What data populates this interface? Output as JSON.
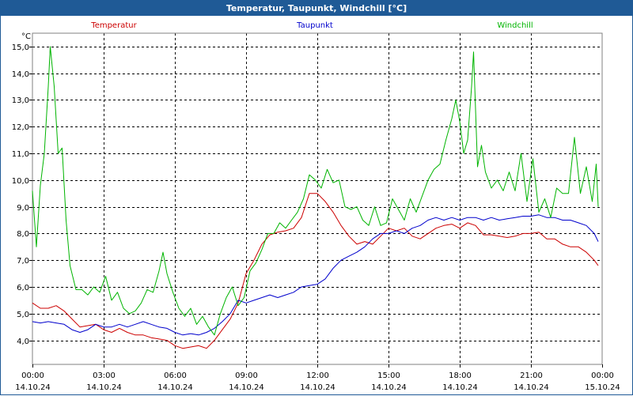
{
  "window": {
    "title": "Temperatur, Taupunkt, Windchill [°C]"
  },
  "colors": {
    "titlebar": "#1f5a96",
    "temperatur": "#cc0000",
    "taupunkt": "#0000cc",
    "windchill": "#00b400",
    "grid": "#000000"
  },
  "chart_data": {
    "type": "line",
    "title": "Temperatur, Taupunkt, Windchill [°C]",
    "ylabel": "°C",
    "xlabel": "",
    "grid": true,
    "legend_position": "top",
    "xlim": [
      "14.10.24 00:00",
      "15.10.24 00:00"
    ],
    "ylim": [
      3.1,
      15.5
    ],
    "y_ticks": [
      "4,0",
      "5,0",
      "6,0",
      "7,0",
      "8,0",
      "9,0",
      "10,0",
      "11,0",
      "12,0",
      "13,0",
      "14,0",
      "15,0"
    ],
    "x_ticks": [
      {
        "time": "00:00",
        "date": "14.10.24"
      },
      {
        "time": "03:00",
        "date": "14.10.24"
      },
      {
        "time": "06:00",
        "date": "14.10.24"
      },
      {
        "time": "09:00",
        "date": "14.10.24"
      },
      {
        "time": "12:00",
        "date": "14.10.24"
      },
      {
        "time": "15:00",
        "date": "14.10.24"
      },
      {
        "time": "18:00",
        "date": "14.10.24"
      },
      {
        "time": "21:00",
        "date": "14.10.24"
      },
      {
        "time": "00:00",
        "date": "15.10.24"
      }
    ],
    "series": [
      {
        "name": "Temperatur",
        "color": "#cc0000",
        "points": [
          [
            "00:00",
            5.4
          ],
          [
            "00:20",
            5.2
          ],
          [
            "00:40",
            5.2
          ],
          [
            "01:00",
            5.3
          ],
          [
            "01:20",
            5.1
          ],
          [
            "01:40",
            4.8
          ],
          [
            "02:00",
            4.5
          ],
          [
            "02:20",
            4.55
          ],
          [
            "02:40",
            4.6
          ],
          [
            "03:00",
            4.4
          ],
          [
            "03:20",
            4.3
          ],
          [
            "03:40",
            4.45
          ],
          [
            "04:00",
            4.3
          ],
          [
            "04:20",
            4.2
          ],
          [
            "04:40",
            4.2
          ],
          [
            "05:00",
            4.1
          ],
          [
            "05:20",
            4.05
          ],
          [
            "05:40",
            4.0
          ],
          [
            "06:00",
            3.8
          ],
          [
            "06:20",
            3.7
          ],
          [
            "06:40",
            3.75
          ],
          [
            "07:00",
            3.8
          ],
          [
            "07:20",
            3.7
          ],
          [
            "07:40",
            4.0
          ],
          [
            "08:00",
            4.4
          ],
          [
            "08:20",
            4.8
          ],
          [
            "08:40",
            5.4
          ],
          [
            "09:00",
            6.5
          ],
          [
            "09:20",
            7.0
          ],
          [
            "09:40",
            7.6
          ],
          [
            "10:00",
            7.95
          ],
          [
            "10:20",
            8.05
          ],
          [
            "10:40",
            8.1
          ],
          [
            "11:00",
            8.2
          ],
          [
            "11:20",
            8.6
          ],
          [
            "11:40",
            9.5
          ],
          [
            "12:00",
            9.5
          ],
          [
            "12:20",
            9.2
          ],
          [
            "12:40",
            8.8
          ],
          [
            "13:00",
            8.3
          ],
          [
            "13:20",
            7.9
          ],
          [
            "13:40",
            7.6
          ],
          [
            "14:00",
            7.7
          ],
          [
            "14:20",
            7.6
          ],
          [
            "14:40",
            7.9
          ],
          [
            "15:00",
            8.2
          ],
          [
            "15:20",
            8.1
          ],
          [
            "15:40",
            8.2
          ],
          [
            "16:00",
            7.9
          ],
          [
            "16:20",
            7.8
          ],
          [
            "16:40",
            8.0
          ],
          [
            "17:00",
            8.2
          ],
          [
            "17:20",
            8.3
          ],
          [
            "17:40",
            8.35
          ],
          [
            "18:00",
            8.2
          ],
          [
            "18:20",
            8.4
          ],
          [
            "18:40",
            8.3
          ],
          [
            "19:00",
            7.95
          ],
          [
            "19:20",
            7.95
          ],
          [
            "19:40",
            7.9
          ],
          [
            "20:00",
            7.85
          ],
          [
            "20:20",
            7.9
          ],
          [
            "20:40",
            8.0
          ],
          [
            "21:00",
            8.0
          ],
          [
            "21:20",
            8.05
          ],
          [
            "21:40",
            7.8
          ],
          [
            "22:00",
            7.8
          ],
          [
            "22:20",
            7.6
          ],
          [
            "22:40",
            7.5
          ],
          [
            "23:00",
            7.5
          ],
          [
            "23:20",
            7.3
          ],
          [
            "23:40",
            7.0
          ],
          [
            "23:50",
            6.8
          ]
        ]
      },
      {
        "name": "Taupunkt",
        "color": "#0000cc",
        "points": [
          [
            "00:00",
            4.7
          ],
          [
            "00:20",
            4.65
          ],
          [
            "00:40",
            4.7
          ],
          [
            "01:00",
            4.65
          ],
          [
            "01:20",
            4.6
          ],
          [
            "01:40",
            4.4
          ],
          [
            "02:00",
            4.3
          ],
          [
            "02:20",
            4.4
          ],
          [
            "02:40",
            4.6
          ],
          [
            "03:00",
            4.5
          ],
          [
            "03:20",
            4.5
          ],
          [
            "03:40",
            4.6
          ],
          [
            "04:00",
            4.5
          ],
          [
            "04:20",
            4.6
          ],
          [
            "04:40",
            4.7
          ],
          [
            "05:00",
            4.6
          ],
          [
            "05:20",
            4.5
          ],
          [
            "05:40",
            4.45
          ],
          [
            "06:00",
            4.3
          ],
          [
            "06:20",
            4.2
          ],
          [
            "06:40",
            4.25
          ],
          [
            "07:00",
            4.2
          ],
          [
            "07:20",
            4.3
          ],
          [
            "07:40",
            4.45
          ],
          [
            "08:00",
            4.7
          ],
          [
            "08:20",
            5.0
          ],
          [
            "08:40",
            5.5
          ],
          [
            "09:00",
            5.4
          ],
          [
            "09:20",
            5.5
          ],
          [
            "09:40",
            5.6
          ],
          [
            "10:00",
            5.7
          ],
          [
            "10:20",
            5.6
          ],
          [
            "10:40",
            5.7
          ],
          [
            "11:00",
            5.8
          ],
          [
            "11:20",
            6.0
          ],
          [
            "11:40",
            6.05
          ],
          [
            "12:00",
            6.1
          ],
          [
            "12:20",
            6.3
          ],
          [
            "12:40",
            6.7
          ],
          [
            "13:00",
            7.0
          ],
          [
            "13:20",
            7.15
          ],
          [
            "13:40",
            7.3
          ],
          [
            "14:00",
            7.5
          ],
          [
            "14:20",
            7.8
          ],
          [
            "14:40",
            8.0
          ],
          [
            "15:00",
            8.0
          ],
          [
            "15:20",
            8.1
          ],
          [
            "15:40",
            8.0
          ],
          [
            "16:00",
            8.2
          ],
          [
            "16:20",
            8.3
          ],
          [
            "16:40",
            8.5
          ],
          [
            "17:00",
            8.6
          ],
          [
            "17:20",
            8.5
          ],
          [
            "17:40",
            8.6
          ],
          [
            "18:00",
            8.5
          ],
          [
            "18:20",
            8.6
          ],
          [
            "18:40",
            8.6
          ],
          [
            "19:00",
            8.5
          ],
          [
            "19:20",
            8.6
          ],
          [
            "19:40",
            8.5
          ],
          [
            "20:00",
            8.55
          ],
          [
            "20:20",
            8.6
          ],
          [
            "20:40",
            8.65
          ],
          [
            "21:00",
            8.65
          ],
          [
            "21:20",
            8.7
          ],
          [
            "21:40",
            8.6
          ],
          [
            "22:00",
            8.6
          ],
          [
            "22:20",
            8.5
          ],
          [
            "22:40",
            8.5
          ],
          [
            "23:00",
            8.4
          ],
          [
            "23:20",
            8.3
          ],
          [
            "23:40",
            8.0
          ],
          [
            "23:50",
            7.7
          ]
        ]
      },
      {
        "name": "Windchill",
        "color": "#00b400",
        "points": [
          [
            "00:00",
            9.6
          ],
          [
            "00:10",
            7.5
          ],
          [
            "00:20",
            9.8
          ],
          [
            "00:30",
            11.0
          ],
          [
            "00:40",
            13.5
          ],
          [
            "00:45",
            15.0
          ],
          [
            "00:55",
            13.5
          ],
          [
            "01:05",
            11.0
          ],
          [
            "01:15",
            11.2
          ],
          [
            "01:25",
            8.5
          ],
          [
            "01:35",
            6.8
          ],
          [
            "01:50",
            5.9
          ],
          [
            "02:05",
            5.9
          ],
          [
            "02:20",
            5.7
          ],
          [
            "02:35",
            6.0
          ],
          [
            "02:50",
            5.8
          ],
          [
            "03:05",
            6.4
          ],
          [
            "03:20",
            5.5
          ],
          [
            "03:35",
            5.8
          ],
          [
            "03:50",
            5.2
          ],
          [
            "04:05",
            5.0
          ],
          [
            "04:20",
            5.1
          ],
          [
            "04:35",
            5.4
          ],
          [
            "04:50",
            5.9
          ],
          [
            "05:05",
            5.8
          ],
          [
            "05:20",
            6.6
          ],
          [
            "05:30",
            7.3
          ],
          [
            "05:40",
            6.5
          ],
          [
            "05:55",
            5.8
          ],
          [
            "06:10",
            5.2
          ],
          [
            "06:25",
            4.9
          ],
          [
            "06:40",
            5.2
          ],
          [
            "06:55",
            4.6
          ],
          [
            "07:10",
            4.9
          ],
          [
            "07:25",
            4.5
          ],
          [
            "07:40",
            4.2
          ],
          [
            "07:55",
            5.0
          ],
          [
            "08:10",
            5.6
          ],
          [
            "08:25",
            6.0
          ],
          [
            "08:40",
            5.3
          ],
          [
            "08:55",
            5.6
          ],
          [
            "09:10",
            6.6
          ],
          [
            "09:25",
            6.9
          ],
          [
            "09:40",
            7.4
          ],
          [
            "09:55",
            8.0
          ],
          [
            "10:10",
            8.0
          ],
          [
            "10:25",
            8.4
          ],
          [
            "10:40",
            8.2
          ],
          [
            "10:55",
            8.5
          ],
          [
            "11:10",
            8.8
          ],
          [
            "11:25",
            9.3
          ],
          [
            "11:40",
            10.2
          ],
          [
            "11:55",
            10.0
          ],
          [
            "12:10",
            9.7
          ],
          [
            "12:25",
            10.4
          ],
          [
            "12:40",
            9.9
          ],
          [
            "12:55",
            10.0
          ],
          [
            "13:10",
            9.0
          ],
          [
            "13:25",
            8.9
          ],
          [
            "13:40",
            9.0
          ],
          [
            "13:55",
            8.5
          ],
          [
            "14:10",
            8.3
          ],
          [
            "14:25",
            9.0
          ],
          [
            "14:40",
            8.3
          ],
          [
            "14:55",
            8.4
          ],
          [
            "15:10",
            9.3
          ],
          [
            "15:25",
            8.9
          ],
          [
            "15:40",
            8.5
          ],
          [
            "15:55",
            9.3
          ],
          [
            "16:10",
            8.8
          ],
          [
            "16:25",
            9.4
          ],
          [
            "16:40",
            10.0
          ],
          [
            "16:55",
            10.4
          ],
          [
            "17:10",
            10.6
          ],
          [
            "17:25",
            11.5
          ],
          [
            "17:40",
            12.3
          ],
          [
            "17:50",
            13.0
          ],
          [
            "18:00",
            12.2
          ],
          [
            "18:10",
            11.0
          ],
          [
            "18:20",
            11.5
          ],
          [
            "18:30",
            13.5
          ],
          [
            "18:35",
            14.8
          ],
          [
            "18:45",
            10.5
          ],
          [
            "18:55",
            11.3
          ],
          [
            "19:05",
            10.3
          ],
          [
            "19:20",
            9.7
          ],
          [
            "19:35",
            10.0
          ],
          [
            "19:50",
            9.6
          ],
          [
            "20:05",
            10.3
          ],
          [
            "20:20",
            9.6
          ],
          [
            "20:35",
            11.0
          ],
          [
            "20:50",
            9.2
          ],
          [
            "21:05",
            10.8
          ],
          [
            "21:20",
            8.8
          ],
          [
            "21:35",
            9.3
          ],
          [
            "21:50",
            8.6
          ],
          [
            "22:05",
            9.7
          ],
          [
            "22:20",
            9.5
          ],
          [
            "22:35",
            9.5
          ],
          [
            "22:50",
            11.6
          ],
          [
            "23:05",
            9.5
          ],
          [
            "23:20",
            10.5
          ],
          [
            "23:35",
            9.2
          ],
          [
            "23:45",
            10.6
          ],
          [
            "23:50",
            9.0
          ]
        ]
      }
    ]
  }
}
